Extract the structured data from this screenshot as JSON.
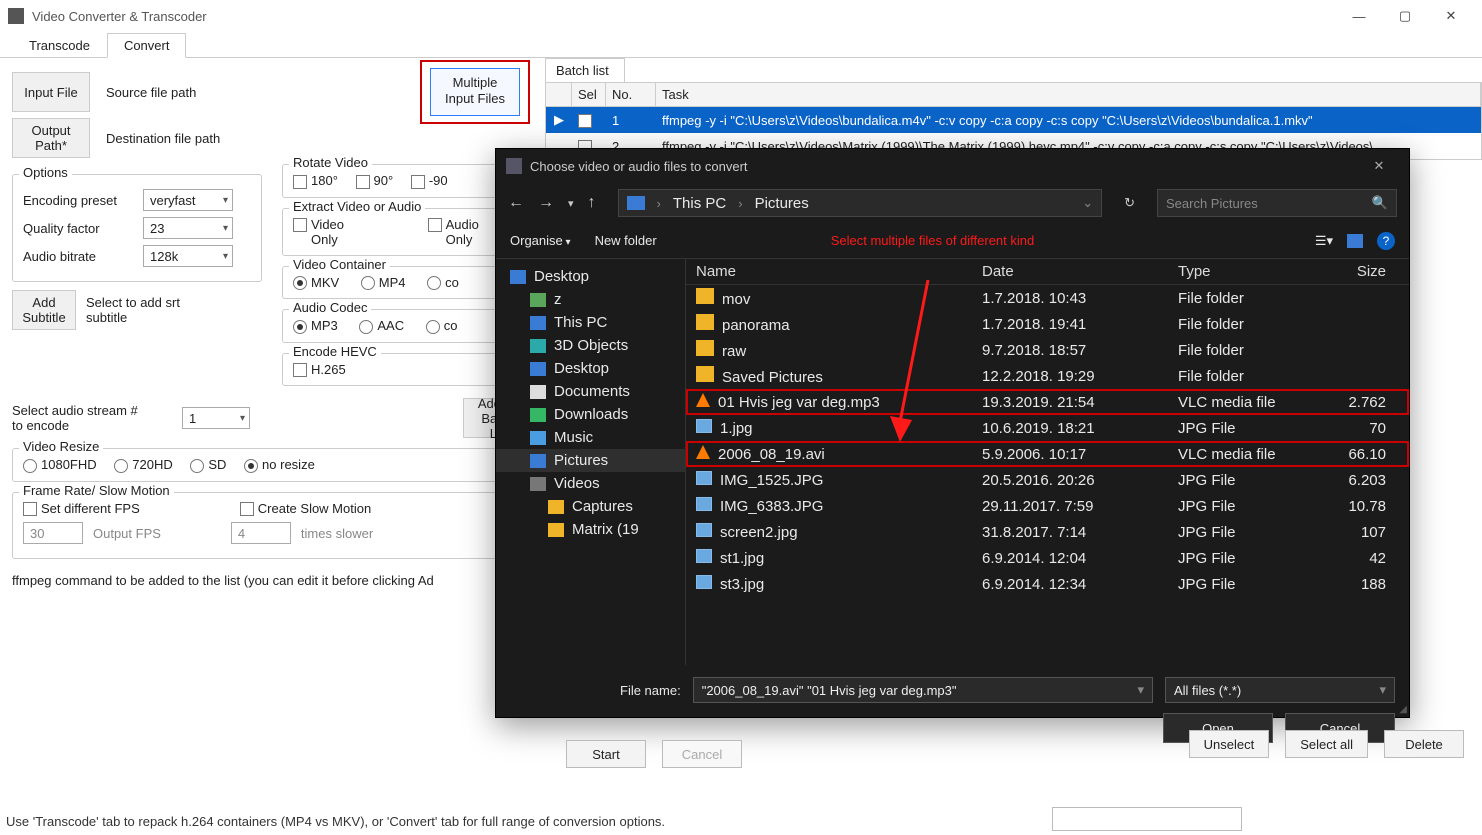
{
  "window": {
    "title": "Video Converter & Transcoder"
  },
  "tabs": {
    "transcode": "Transcode",
    "convert": "Convert"
  },
  "convert": {
    "input_file_btn": "Input File",
    "output_path_btn": "Output\nPath*",
    "source_label": "Source file path",
    "dest_label": "Destination file path",
    "multiple_btn": "Multiple\nInput Files",
    "rotate_title": "Rotate Video",
    "rotate_180": "180°",
    "rotate_90": "90°",
    "rotate_neg90": "-90",
    "extract_title": "Extract Video or Audio",
    "video_only": "Video\nOnly",
    "audio_only": "Audio\nOnly",
    "container_title": "Video Container",
    "mkv": "MKV",
    "mp4": "MP4",
    "container_co": "co",
    "codec_title": "Audio Codec",
    "mp3": "MP3",
    "aac": "AAC",
    "codec_co": "co",
    "hevc_title": "Encode HEVC",
    "h265": "H.265",
    "options_title": "Options",
    "preset_label": "Encoding preset",
    "preset_value": "veryfast",
    "quality_label": "Quality factor",
    "quality_value": "23",
    "audiobr_label": "Audio bitrate",
    "audiobr_value": "128k",
    "addsub_btn": "Add\nSubtitle",
    "addsub_label": "Select to add srt\nsubtitle",
    "audiostream_label": "Select audio stream #\nto encode",
    "audiostream_value": "1",
    "resize_title": "Video Resize",
    "r1080": "1080FHD",
    "r720": "720HD",
    "rsd": "SD",
    "rnone": "no resize",
    "fps_title": "Frame Rate/ Slow Motion",
    "fps_chk": "Set different FPS",
    "fps_val": "30",
    "fps_hint": "Output FPS",
    "slow_chk": "Create Slow Motion",
    "slow_val": "4",
    "slow_hint": "times slower",
    "addto_btn": "Add To\nBatch Lis",
    "cmd_label": "ffmpeg command to be added to the list (you can edit it before clicking Ad"
  },
  "batch": {
    "title": "Batch list",
    "cols": {
      "sel": "Sel",
      "no": "No.",
      "task": "Task"
    },
    "rows": [
      {
        "no": "1",
        "task": "ffmpeg -y -i \"C:\\Users\\z\\Videos\\bundalica.m4v\" -c:v copy -c:a copy -c:s copy \"C:\\Users\\z\\Videos\\bundalica.1.mkv\""
      },
      {
        "no": "2",
        "task": "ffmpeg -y -i \"C:\\Users\\z\\Videos\\Matrix (1999)\\The Matrix (1999).hevc.mp4\" -c:v copy -c:a copy -c:s copy \"C:\\Users\\z\\Videos\\"
      }
    ],
    "start": "Start",
    "cancel": "Cancel",
    "unselect": "Unselect",
    "selectall": "Select all",
    "delete": "Delete"
  },
  "dlg": {
    "title": "Choose video or audio files to convert",
    "bc_thispc": "This PC",
    "bc_pictures": "Pictures",
    "search_placeholder": "Search Pictures",
    "organise": "Organise",
    "newfolder": "New folder",
    "annotation": "Select multiple files of different kind",
    "tree": {
      "desktop": "Desktop",
      "user": "z",
      "thispc": "This PC",
      "objects3d": "3D Objects",
      "desktop2": "Desktop",
      "documents": "Documents",
      "downloads": "Downloads",
      "music": "Music",
      "pictures": "Pictures",
      "videos": "Videos",
      "captures": "Captures",
      "matrix": "Matrix (19"
    },
    "cols": {
      "name": "Name",
      "date": "Date",
      "type": "Type",
      "size": "Size"
    },
    "files": [
      {
        "icon": "folder",
        "name": "mov",
        "date": "1.7.2018. 10:43",
        "type": "File folder",
        "size": ""
      },
      {
        "icon": "folder",
        "name": "panorama",
        "date": "1.7.2018. 19:41",
        "type": "File folder",
        "size": ""
      },
      {
        "icon": "folder",
        "name": "raw",
        "date": "9.7.2018. 18:57",
        "type": "File folder",
        "size": ""
      },
      {
        "icon": "folder",
        "name": "Saved Pictures",
        "date": "12.2.2018. 19:29",
        "type": "File folder",
        "size": ""
      },
      {
        "icon": "vlc",
        "name": "01 Hvis jeg var deg.mp3",
        "date": "19.3.2019. 21:54",
        "type": "VLC media file",
        "size": "2.762",
        "hl": true
      },
      {
        "icon": "img",
        "name": "1.jpg",
        "date": "10.6.2019. 18:21",
        "type": "JPG File",
        "size": "70"
      },
      {
        "icon": "vlc",
        "name": "2006_08_19.avi",
        "date": "5.9.2006. 10:17",
        "type": "VLC media file",
        "size": "66.10",
        "hl": true
      },
      {
        "icon": "img",
        "name": "IMG_1525.JPG",
        "date": "20.5.2016. 20:26",
        "type": "JPG File",
        "size": "6.203"
      },
      {
        "icon": "img",
        "name": "IMG_6383.JPG",
        "date": "29.11.2017. 7:59",
        "type": "JPG File",
        "size": "10.78"
      },
      {
        "icon": "img",
        "name": "screen2.jpg",
        "date": "31.8.2017. 7:14",
        "type": "JPG File",
        "size": "107"
      },
      {
        "icon": "img",
        "name": "st1.jpg",
        "date": "6.9.2014. 12:04",
        "type": "JPG File",
        "size": "42"
      },
      {
        "icon": "img",
        "name": "st3.jpg",
        "date": "6.9.2014. 12:34",
        "type": "JPG File",
        "size": "188"
      }
    ],
    "filename_label": "File name:",
    "filename_value": "\"2006_08_19.avi\" \"01 Hvis jeg var deg.mp3\"",
    "filter": "All files (*.*)",
    "open": "Open",
    "cancel": "Cancel"
  },
  "status": "Use 'Transcode' tab to repack h.264 containers (MP4 vs MKV), or 'Convert' tab for full range of conversion options."
}
